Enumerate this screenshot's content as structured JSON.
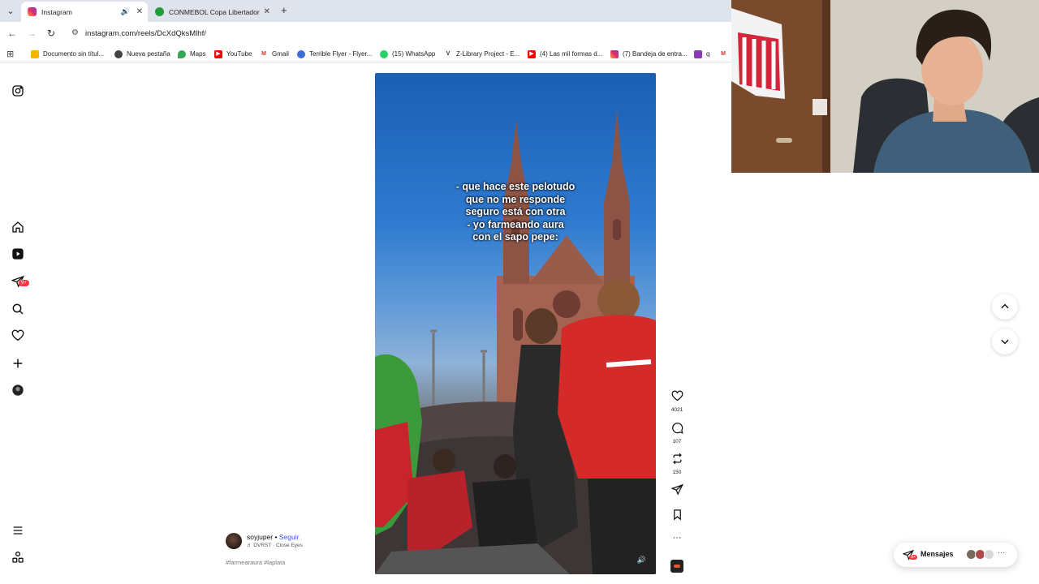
{
  "browser": {
    "tabs": [
      {
        "title": "Instagram",
        "active": true,
        "has_audio": true
      },
      {
        "title": "CONMEBOL Copa Libertadores",
        "active": false,
        "has_audio": false
      }
    ],
    "url": "instagram.com/reels/DcXdQksMlhf/",
    "bookmarks": [
      "Documento sin títul...",
      "Nueva pestaña",
      "Maps",
      "YouTube",
      "Gmail",
      "Terrible Flyer - Flyer...",
      "(15) WhatsApp",
      "Z-Library Project - E...",
      "(4) Las mil formas d...",
      "(7) Bandeja de entra...",
      "q"
    ]
  },
  "nav": {
    "notifications_badge": "9+"
  },
  "reel": {
    "caption": "- que hace este pelotudo\nque no me responde\nseguro está con otra\n- yo farmeando aura\ncon el sapo pepe:",
    "author": "soyjuper",
    "separator": "•",
    "follow_label": "Seguir",
    "audio": "♬ DVRST · Close Eyes",
    "hashtags": "#farmearaura #laplata",
    "likes": "4021",
    "comments": "107",
    "reposts": "150"
  },
  "messages": {
    "label": "Mensajes",
    "badge": "9+"
  },
  "colors": {
    "accent_link": "#4150f7",
    "badge_red": "#ff3040"
  }
}
